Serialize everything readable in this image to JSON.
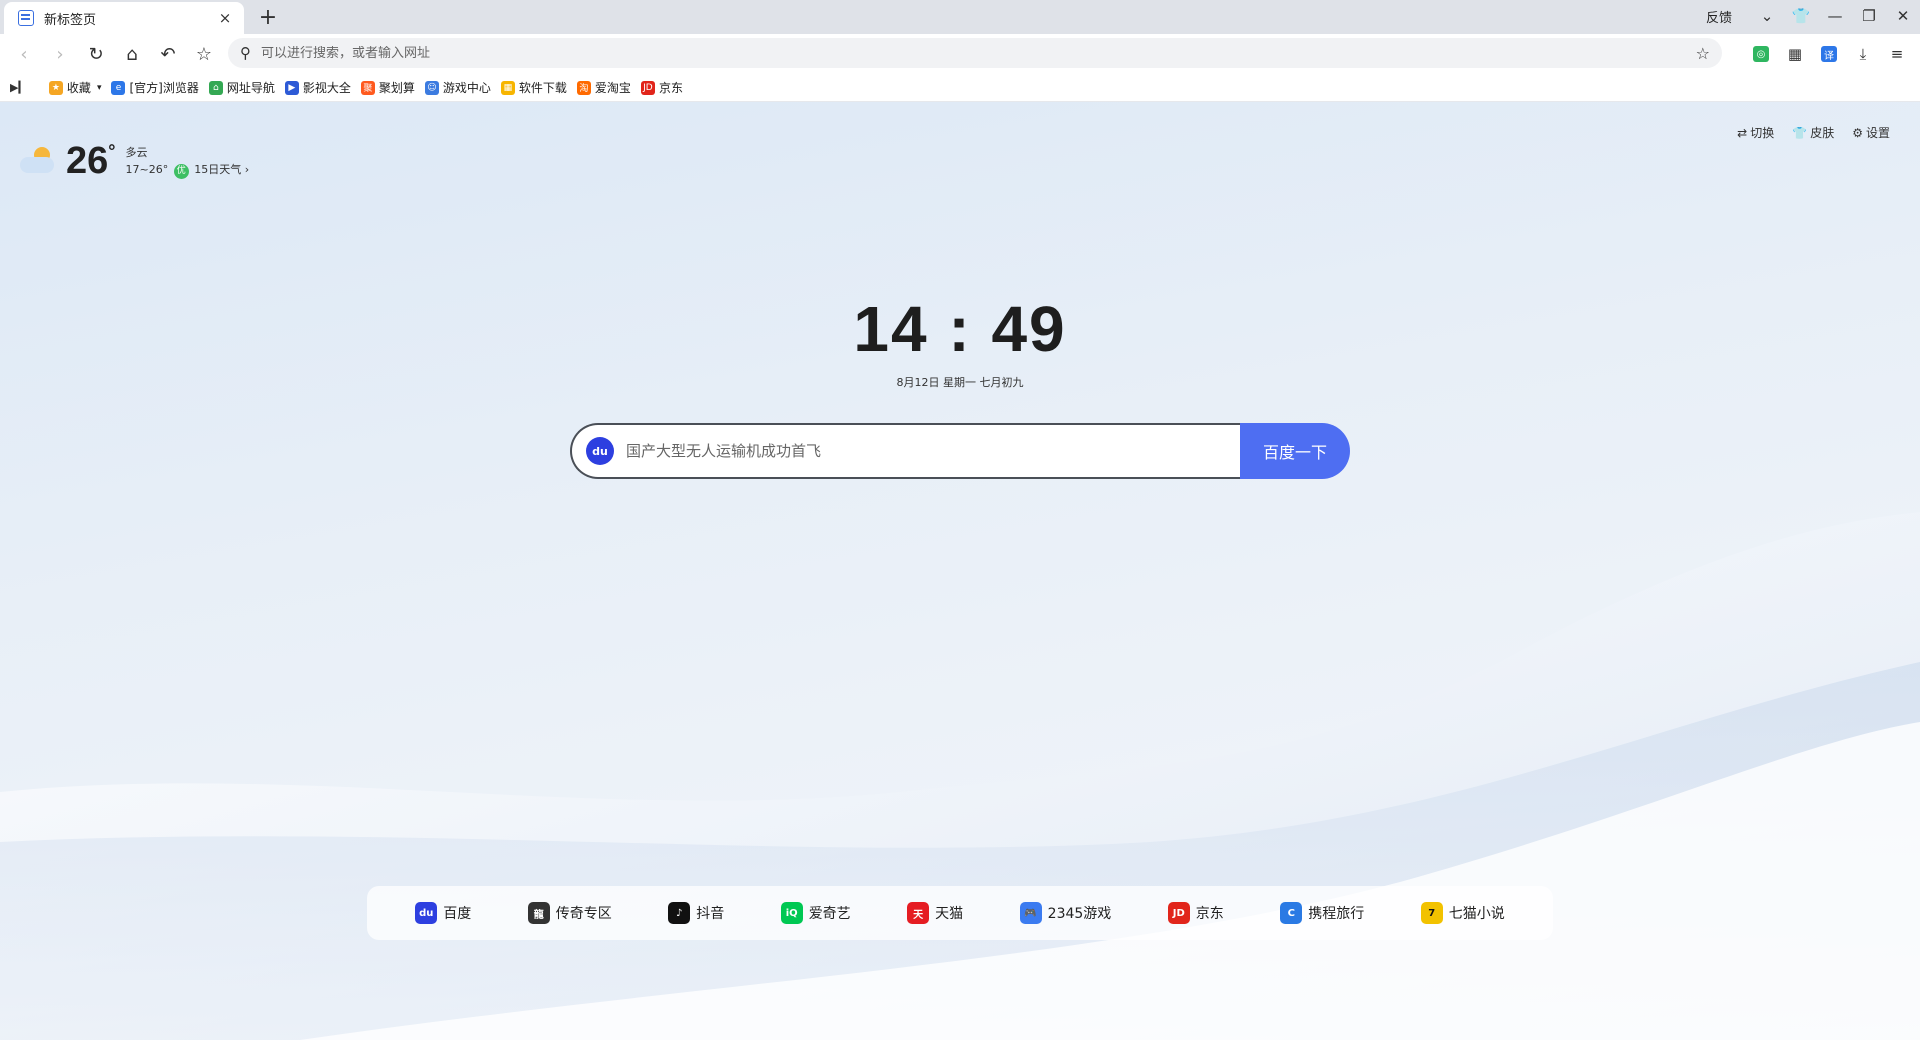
{
  "tab": {
    "title": "新标签页",
    "close": "×",
    "new_tab": "+"
  },
  "window": {
    "feedback": "反馈"
  },
  "address": {
    "placeholder": "可以进行搜索，或者输入网址"
  },
  "bookmarks": [
    {
      "label": "收藏",
      "color": "#f5a623"
    },
    {
      "label": "[官方]浏览器",
      "color": "#2d77e8"
    },
    {
      "label": "网址导航",
      "color": "#34a853"
    },
    {
      "label": "影视大全",
      "color": "#2d5ad6"
    },
    {
      "label": "聚划算",
      "color": "#ff5a1f"
    },
    {
      "label": "游戏中心",
      "color": "#3c7be0"
    },
    {
      "label": "软件下载",
      "color": "#f7b500"
    },
    {
      "label": "爱淘宝",
      "color": "#ff6a00"
    },
    {
      "label": "京东",
      "color": "#e1251b"
    }
  ],
  "weather": {
    "temp": "26",
    "deg": "°",
    "condition": "多云",
    "range": "17~26°",
    "aq": "优",
    "forecast": "15日天气"
  },
  "top_actions": {
    "switch": "切换",
    "skin": "皮肤",
    "settings": "设置"
  },
  "clock": {
    "time": "14 : 49",
    "date": "8月12日  星期一  七月初九"
  },
  "search": {
    "placeholder": "国产大型无人运输机成功首飞",
    "button": "百度一下",
    "logo": "du"
  },
  "quicklinks": [
    {
      "label": "百度",
      "color": "#2d3fe0",
      "icon": "du"
    },
    {
      "label": "传奇专区",
      "color": "#333333",
      "icon": "龍"
    },
    {
      "label": "抖音",
      "color": "#111111",
      "icon": "♪"
    },
    {
      "label": "爱奇艺",
      "color": "#00c853",
      "icon": "iQ"
    },
    {
      "label": "天猫",
      "color": "#e51c23",
      "icon": "天"
    },
    {
      "label": "2345游戏",
      "color": "#3b7bf0",
      "icon": "🎮"
    },
    {
      "label": "京东",
      "color": "#e1251b",
      "icon": "JD"
    },
    {
      "label": "携程旅行",
      "color": "#2a7ae4",
      "icon": "C"
    },
    {
      "label": "七猫小说",
      "color": "#f2c200",
      "icon": "7"
    }
  ],
  "colors": {
    "accent": "#4e6ef2",
    "tabstrip": "#dfe2e8"
  }
}
